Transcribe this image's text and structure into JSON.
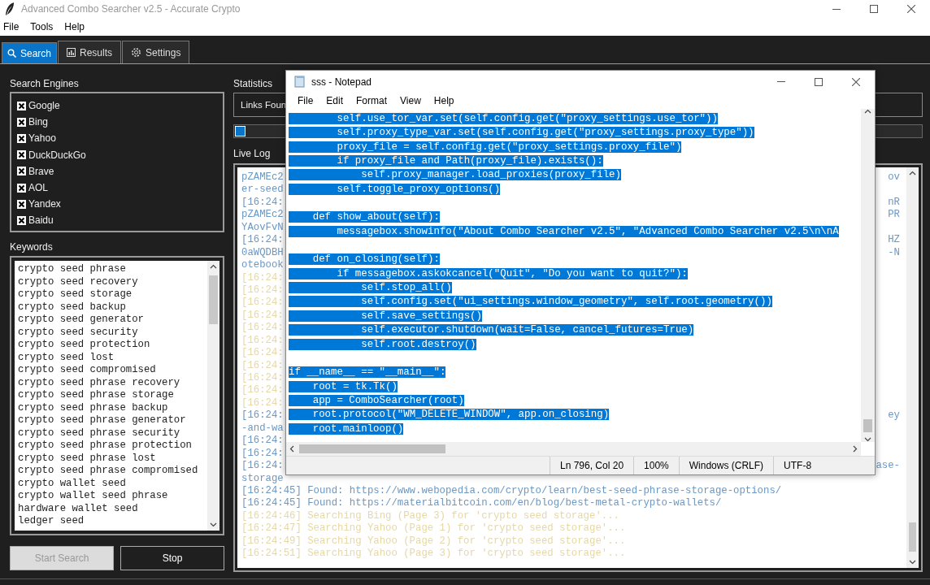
{
  "window": {
    "title": "Advanced Combo Searcher v2.5 - Accurate Crypto"
  },
  "menu": [
    "File",
    "Tools",
    "Help"
  ],
  "tabs": [
    {
      "label": "Search",
      "selected": true
    },
    {
      "label": "Results",
      "selected": false
    },
    {
      "label": "Settings",
      "selected": false
    }
  ],
  "search_engines": {
    "title": "Search Engines",
    "items": [
      {
        "label": "Google",
        "checked": true
      },
      {
        "label": "Bing",
        "checked": true
      },
      {
        "label": "Yahoo",
        "checked": true
      },
      {
        "label": "DuckDuckGo",
        "checked": true
      },
      {
        "label": "Brave",
        "checked": true
      },
      {
        "label": "AOL",
        "checked": true
      },
      {
        "label": "Yandex",
        "checked": true
      },
      {
        "label": "Baidu",
        "checked": true
      }
    ]
  },
  "keywords": {
    "title": "Keywords",
    "items": [
      "crypto seed phrase",
      "crypto seed recovery",
      "crypto seed storage",
      "crypto seed backup",
      "crypto seed generator",
      "crypto seed security",
      "crypto seed protection",
      "crypto seed lost",
      "crypto seed compromised",
      "crypto seed phrase recovery",
      "crypto seed phrase storage",
      "crypto seed phrase backup",
      "crypto seed phrase generator",
      "crypto seed phrase security",
      "crypto seed phrase protection",
      "crypto seed phrase lost",
      "crypto seed phrase compromised",
      "crypto wallet seed",
      "crypto wallet seed phrase",
      "hardware wallet seed",
      "ledger seed"
    ]
  },
  "buttons": [
    {
      "label": "Start Search",
      "disabled": true
    },
    {
      "label": "Stop",
      "disabled": false
    }
  ],
  "statistics": {
    "title": "Statistics",
    "text": "Links Foun",
    "level": 0.015
  },
  "live_log": {
    "title": "Live Log",
    "lines": [
      {
        "kind": "found",
        "text": "pZAMEc2",
        "end": "ov"
      },
      {
        "kind": "found",
        "text": "er-seed"
      },
      {
        "kind": "found",
        "text": "[16:24:",
        "end": "nR"
      },
      {
        "kind": "found",
        "text": "pZAMEc2",
        "end": "PR"
      },
      {
        "kind": "found",
        "text": "YAovFvN"
      },
      {
        "kind": "found",
        "text": "[16:24:",
        "end": "HZ"
      },
      {
        "kind": "found",
        "text": "0aWQDBH",
        "end": "-N"
      },
      {
        "kind": "found",
        "text": "otebook"
      },
      {
        "kind": "search",
        "text": "[16:24:"
      },
      {
        "kind": "search",
        "text": "[16:24:"
      },
      {
        "kind": "search",
        "text": "[16:24:"
      },
      {
        "kind": "search",
        "text": "[16:24:"
      },
      {
        "kind": "search",
        "text": "[16:24:"
      },
      {
        "kind": "search",
        "text": "[16:24:"
      },
      {
        "kind": "search",
        "text": "[16:24:"
      },
      {
        "kind": "search",
        "text": "[16:24:"
      },
      {
        "kind": "search",
        "text": "[16:24:"
      },
      {
        "kind": "search",
        "text": "[16:24:"
      },
      {
        "kind": "search",
        "text": "[16:24:"
      },
      {
        "kind": "found",
        "text": "[16:24:",
        "end": "ey"
      },
      {
        "kind": "found",
        "text": "-and-wa"
      },
      {
        "kind": "found",
        "text": "[16:24:"
      },
      {
        "kind": "found",
        "text": "[16:24:"
      },
      {
        "kind": "found",
        "text": "[16:24:",
        "end": "ase-"
      },
      {
        "kind": "found",
        "text": "storage"
      },
      {
        "kind": "found",
        "text": "[16:24:45] Found: https://www.webopedia.com/crypto/learn/best-seed-phrase-storage-options/"
      },
      {
        "kind": "found",
        "text": "[16:24:45] Found: https://materialbitcoin.com/en/blog/best-metal-crypto-wallets/"
      },
      {
        "kind": "search",
        "text": "[16:24:46] Searching Bing (Page 3) for 'crypto seed storage'..."
      },
      {
        "kind": "search",
        "text": "[16:24:47] Searching Yahoo (Page 1) for 'crypto seed storage'..."
      },
      {
        "kind": "search",
        "text": "[16:24:49] Searching Yahoo (Page 2) for 'crypto seed storage'..."
      },
      {
        "kind": "search",
        "text": "[16:24:51] Searching Yahoo (Page 3) for 'crypto seed storage'..."
      }
    ]
  },
  "notepad": {
    "title": "sss - Notepad",
    "menu": [
      "File",
      "Edit",
      "Format",
      "View",
      "Help"
    ],
    "lines": [
      {
        "kind": "code",
        "text": "        self.use_tor_var.set(self.config.get(\"proxy_settings.use_tor\"))",
        "selected": true
      },
      {
        "kind": "code",
        "text": "        self.proxy_type_var.set(self.config.get(\"proxy_settings.proxy_type\"))",
        "selected": true
      },
      {
        "kind": "code",
        "text": "        proxy_file = self.config.get(\"proxy_settings.proxy_file\")",
        "selected": true
      },
      {
        "kind": "code",
        "text": "        if proxy_file and Path(proxy_file).exists():",
        "selected": true
      },
      {
        "kind": "code",
        "text": "            self.proxy_manager.load_proxies(proxy_file)",
        "selected": true
      },
      {
        "kind": "code",
        "text": "        self.toggle_proxy_options()",
        "selected": true
      },
      {
        "kind": "blank"
      },
      {
        "kind": "code",
        "text": "    def show_about(self):",
        "selected": true
      },
      {
        "kind": "code",
        "text": "        messagebox.showinfo(\"About Combo Searcher v2.5\", \"Advanced Combo Searcher v2.5\\n\\nA",
        "selected": true
      },
      {
        "kind": "blank"
      },
      {
        "kind": "code",
        "text": "    def on_closing(self):",
        "selected": true
      },
      {
        "kind": "code",
        "text": "        if messagebox.askokcancel(\"Quit\", \"Do you want to quit?\"):",
        "selected": true
      },
      {
        "kind": "code",
        "text": "            self.stop_all()",
        "selected": true
      },
      {
        "kind": "code",
        "text": "            self.config.set(\"ui_settings.window_geometry\", self.root.geometry())",
        "selected": true
      },
      {
        "kind": "code",
        "text": "            self.save_settings()",
        "selected": true
      },
      {
        "kind": "code",
        "text": "            self.executor.shutdown(wait=False, cancel_futures=True)",
        "selected": true
      },
      {
        "kind": "code",
        "text": "            self.root.destroy()",
        "selected": true
      },
      {
        "kind": "blank"
      },
      {
        "kind": "code",
        "text": "if __name__ == \"__main__\":",
        "selected": true
      },
      {
        "kind": "code",
        "text": "    root = tk.Tk()",
        "selected": true
      },
      {
        "kind": "code",
        "text": "    app = ComboSearcher(root)",
        "selected": true
      },
      {
        "kind": "code",
        "text": "    root.protocol(\"WM_DELETE_WINDOW\", app.on_closing)",
        "selected": true
      },
      {
        "kind": "code",
        "text": "    root.mainloop()",
        "selected": true
      }
    ],
    "status": [
      "Ln 796, Col 20",
      "100%",
      "Windows (CRLF)",
      "UTF-8"
    ]
  }
}
